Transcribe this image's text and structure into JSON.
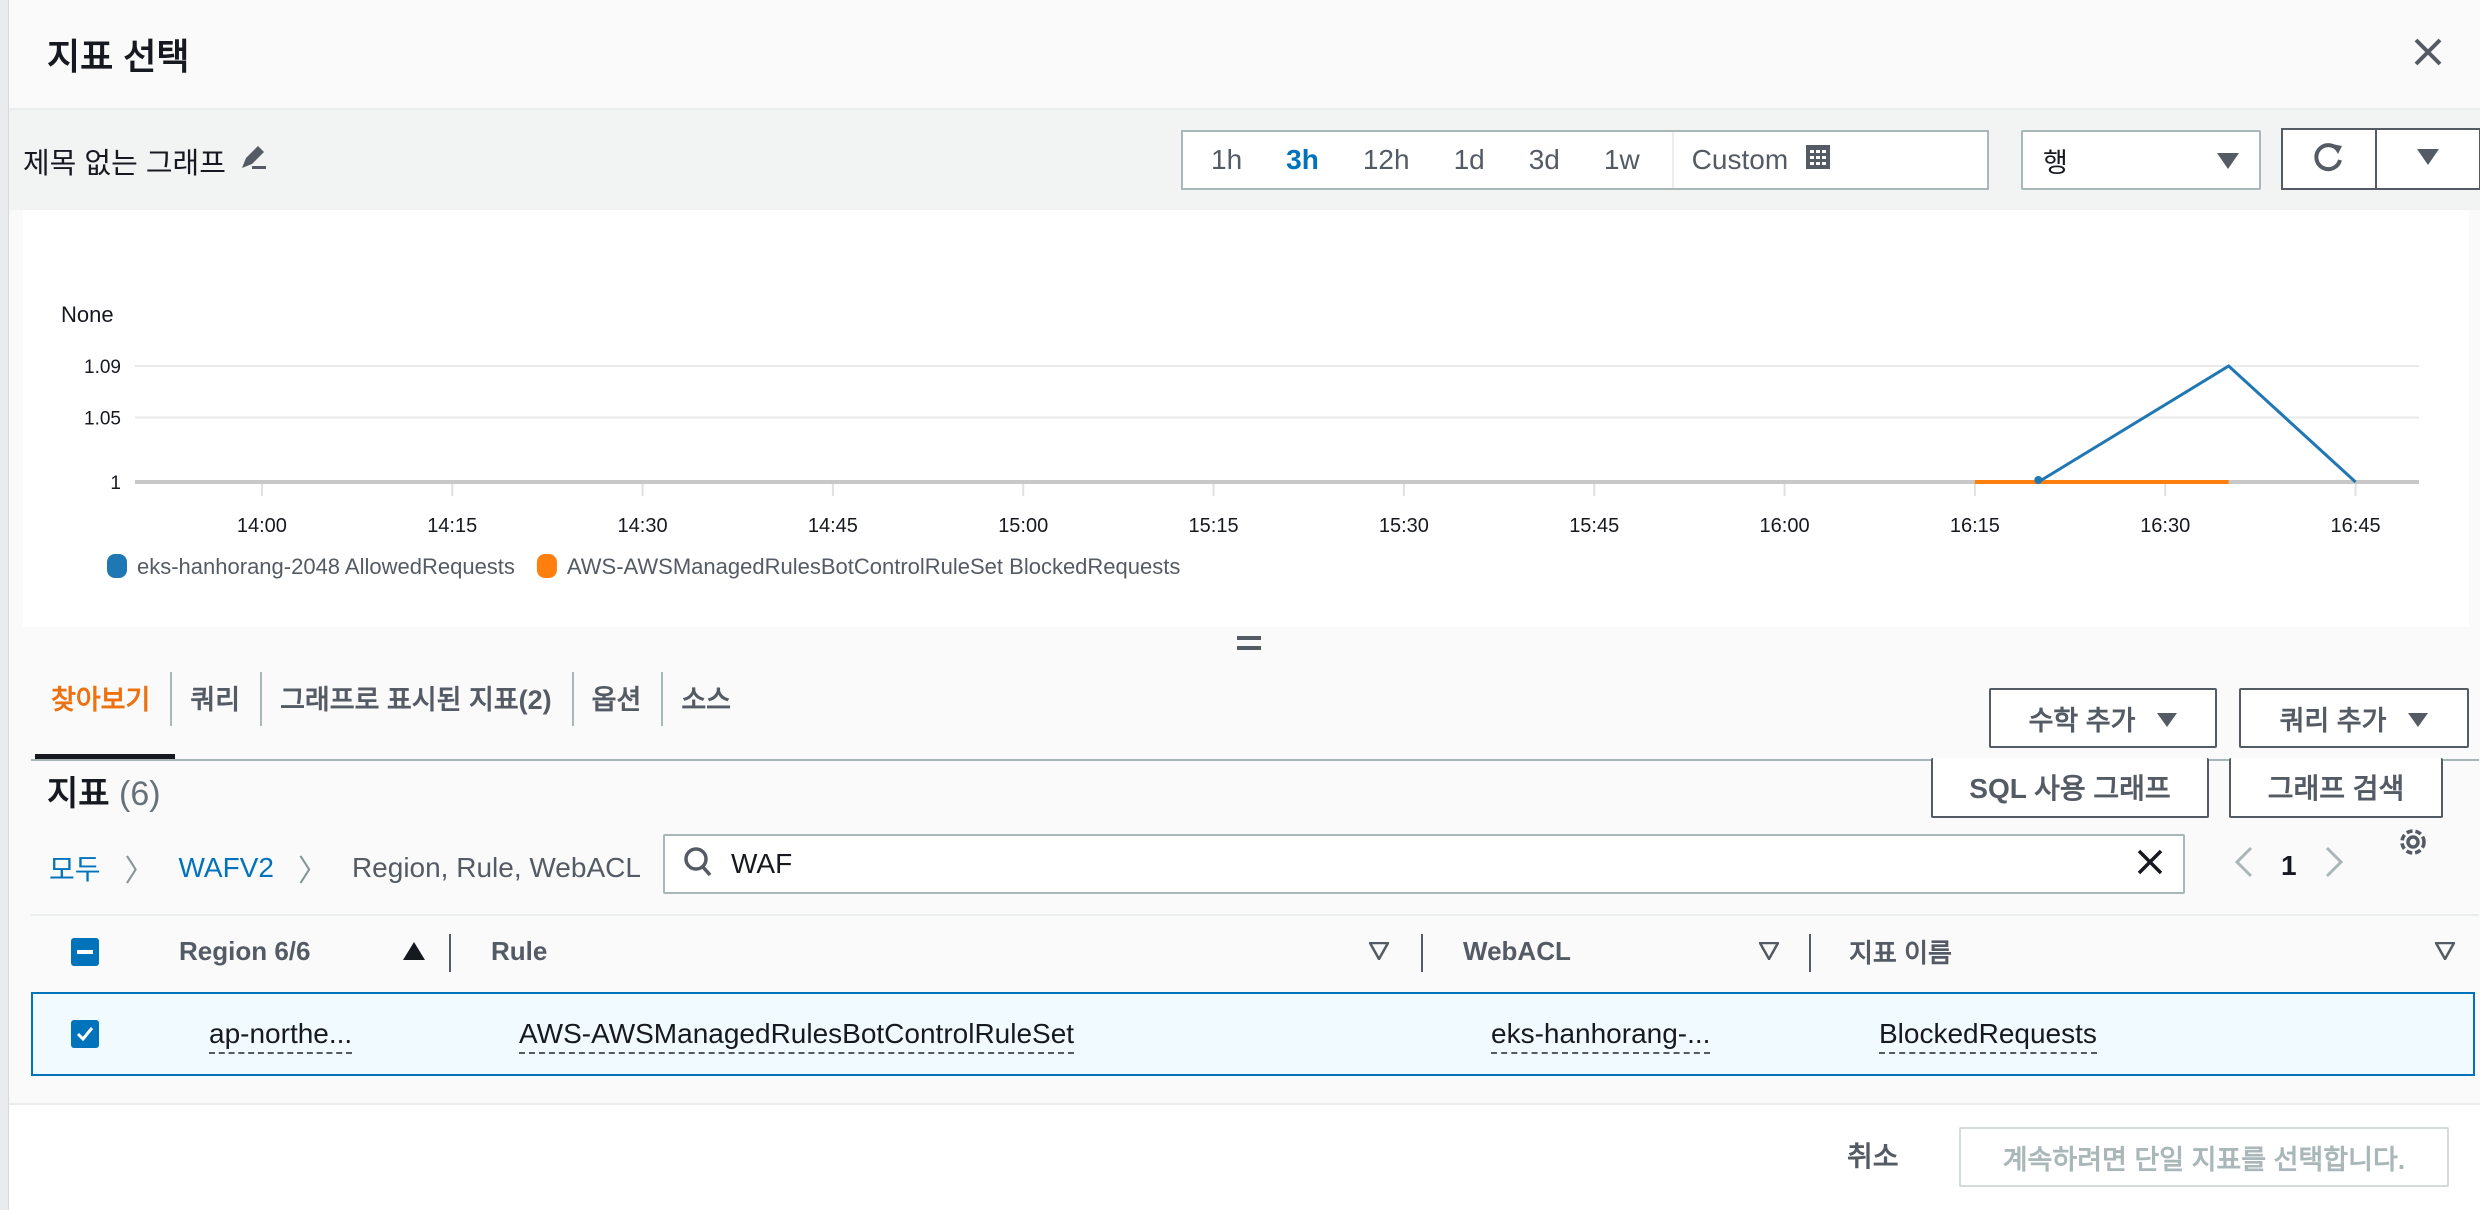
{
  "header": {
    "title": "지표 선택",
    "close_icon": "close-icon"
  },
  "toolbar": {
    "graph_title": "제목 없는 그래프",
    "edit_icon": "pencil-icon",
    "time_ranges": [
      {
        "label": "1h",
        "active": false
      },
      {
        "label": "3h",
        "active": true
      },
      {
        "label": "12h",
        "active": false
      },
      {
        "label": "1d",
        "active": false
      },
      {
        "label": "3d",
        "active": false
      },
      {
        "label": "1w",
        "active": false
      }
    ],
    "custom_label": "Custom",
    "view_select": "행",
    "refresh_icon": "refresh-icon"
  },
  "chart_data": {
    "type": "line",
    "ylabel": "None",
    "y_ticks": [
      "1.09",
      "1.05",
      "1"
    ],
    "ylim": [
      1,
      1.09
    ],
    "x_ticks": [
      "14:00",
      "14:15",
      "14:30",
      "14:45",
      "15:00",
      "15:15",
      "15:30",
      "15:45",
      "16:00",
      "16:15",
      "16:30",
      "16:45"
    ],
    "x_range": [
      "13:50",
      "16:50"
    ],
    "grid": true,
    "legend": "bottom-left",
    "series": [
      {
        "name": "eks-hanhorang-2048 AllowedRequests",
        "color": "#1f77b4",
        "points": [
          [
            "16:20",
            1
          ],
          [
            "16:35",
            1.09
          ],
          [
            "16:45",
            1
          ]
        ]
      },
      {
        "name": "AWS-AWSManagedRulesBotControlRuleSet BlockedRequests",
        "color": "#ff7f0e",
        "points": [
          [
            "16:15",
            1
          ],
          [
            "16:35",
            1
          ]
        ]
      }
    ]
  },
  "tabs": [
    {
      "label": "찾아보기",
      "active": true
    },
    {
      "label": "쿼리",
      "active": false
    },
    {
      "label": "그래프로 표시된 지표(2)",
      "active": false
    },
    {
      "label": "옵션",
      "active": false
    },
    {
      "label": "소스",
      "active": false
    }
  ],
  "actions": {
    "add_math": "수학 추가",
    "add_query": "쿼리 추가"
  },
  "metrics": {
    "title": "지표",
    "count": "(6)",
    "sql_button": "SQL 사용 그래프",
    "search_graph_button": "그래프 검색",
    "breadcrumb": [
      "모두",
      "WAFV2",
      "Region, Rule, WebACL"
    ],
    "search_value": "WAF",
    "page": "1",
    "columns": [
      "Region 6/6",
      "Rule",
      "WebACL",
      "지표 이름"
    ],
    "rows": [
      {
        "checked": true,
        "region": "ap-northe...",
        "rule": "AWS-AWSManagedRulesBotControlRuleSet",
        "webacl": "eks-hanhorang-...",
        "metric": "BlockedRequests"
      }
    ]
  },
  "footer": {
    "cancel": "취소",
    "confirm": "계속하려면 단일 지표를 선택합니다."
  }
}
